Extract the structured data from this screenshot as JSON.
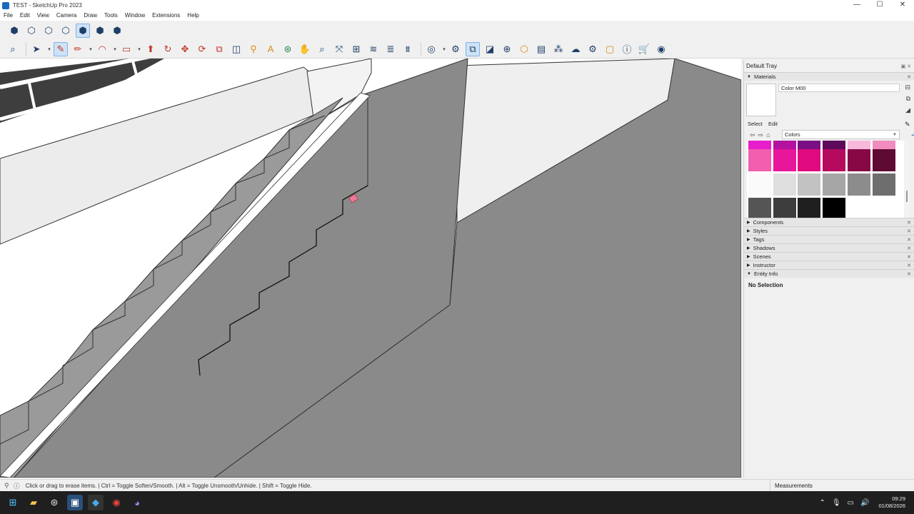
{
  "window": {
    "title": "TEST - SketchUp Pro 2023",
    "minimize": "—",
    "maximize": "☐",
    "close": "✕"
  },
  "menu": [
    "File",
    "Edit",
    "View",
    "Camera",
    "Draw",
    "Tools",
    "Window",
    "Extensions",
    "Help"
  ],
  "tray": {
    "title": "Default Tray",
    "controls": "▣ ✕",
    "materials": {
      "header": "Materials",
      "current_name": "Color M00",
      "tab_select": "Select",
      "tab_edit": "Edit",
      "collection": "Colors",
      "swatch_colors": [
        [
          "#e61ecb",
          "#b3129e",
          "#7a0f84",
          "#5d0a5a",
          "#f7b8dc",
          "#f28cc0"
        ],
        [
          "#f25fae",
          "#e8169a",
          "#e0097d",
          "#b60a5f",
          "#870845",
          "#5e0a33"
        ],
        [
          "#fafafa",
          "#dedede",
          "#c2c2c2",
          "#a6a6a6",
          "#8c8c8c",
          "#6e6e6e"
        ],
        [
          "#555555",
          "#3d3d3d",
          "#1f1f1f",
          "#000000",
          "",
          ""
        ]
      ]
    },
    "panels": [
      "Components",
      "Styles",
      "Tags",
      "Shadows",
      "Scenes",
      "Instructor",
      "Entity Info"
    ],
    "entity_info_text": "No Selection"
  },
  "status": {
    "text": "Click or drag to erase items. | Ctrl = Toggle Soften/Smooth. | Alt = Toggle Unsmooth/Unhide. | Shift = Toggle Hide.",
    "measurements_label": "Measurements"
  },
  "taskbar": {
    "time": "09:29",
    "date": "01/08/2026"
  }
}
